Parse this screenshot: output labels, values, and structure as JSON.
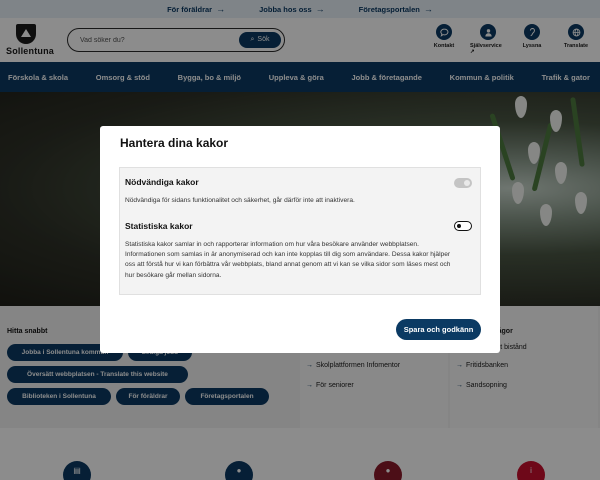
{
  "top_links": [
    {
      "label": "För föräldrar",
      "icon": "arrow-right-icon"
    },
    {
      "label": "Jobba hos oss",
      "icon": "arrow-right-icon"
    },
    {
      "label": "Företagsportalen",
      "icon": "arrow-right-icon"
    }
  ],
  "header": {
    "logo_text": "Sollentuna",
    "search": {
      "placeholder": "Vad söker du?",
      "button_label": "Sök"
    },
    "icons": [
      {
        "label": "Kontakt",
        "icon": "chat-icon"
      },
      {
        "label": "Självservice",
        "icon": "person-icon"
      },
      {
        "label": "Lyssna",
        "icon": "listen-icon"
      },
      {
        "label": "Translate",
        "icon": "globe-icon"
      }
    ]
  },
  "nav": {
    "items": [
      "Förskola & skola",
      "Omsorg & stöd",
      "Bygga, bo & miljö",
      "Uppleva & göra",
      "Jobb & företagande",
      "Kommun & politik",
      "Trafik & gator"
    ]
  },
  "quick_links": {
    "title": "Hitta snabbt",
    "pills": [
      "Jobba i Sollentuna kommun",
      "Lediga jobb",
      "Översätt webbplatsen - Translate this website",
      "Biblioteken i Sollentuna",
      "För föräldrar",
      "Företagsportalen"
    ]
  },
  "columns": [
    {
      "title": "",
      "links": [
        "Skolplattformen Infomentor",
        "För seniorer"
      ]
    },
    {
      "title": "Vanligaste frågor",
      "links": [
        "Ekonomiskt bistånd",
        "Fritidsbanken",
        "Sandsopning"
      ]
    }
  ],
  "bottom_icons": [
    {
      "icon": "document-icon",
      "color": "#0b3a63"
    },
    {
      "icon": "chat-icon",
      "color": "#0b3a63"
    },
    {
      "icon": "person-icon",
      "color": "#8b1a2b"
    },
    {
      "icon": "info-icon",
      "color": "#c8102e"
    }
  ],
  "cookie_modal": {
    "title": "Hantera dina kakor",
    "sections": [
      {
        "title": "Nödvändiga kakor",
        "description": "Nödvändiga för sidans funktionalitet och säkerhet, går därför inte att inaktivera.",
        "toggle_state": "disabled-on"
      },
      {
        "title": "Statistiska kakor",
        "description": "Statistiska kakor samlar in och rapporterar information om hur våra besökare använder webbplatsen. Informationen som samlas in är anonymiserad och kan inte kopplas till dig som användare. Dessa kakor hjälper oss att förstå hur vi kan förbättra vår webbplats, bland annat genom att vi kan se vilka sidor som läses mest och hur besökare går mellan sidorna.",
        "toggle_state": "off"
      }
    ],
    "save_label": "Spara och godkänn"
  },
  "colors": {
    "primary": "#0b3a63",
    "top_bar": "#e8f1f8",
    "overlay": "rgba(0,0,0,0.45)"
  }
}
